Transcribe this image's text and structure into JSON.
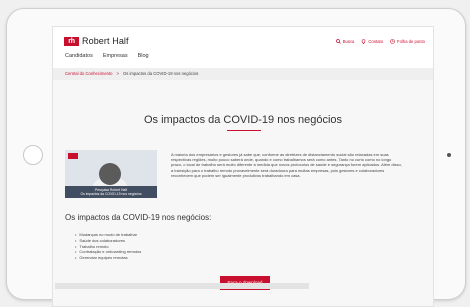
{
  "app": {
    "logo_mark": "rh",
    "logo_text": "Robert Half"
  },
  "utility": {
    "search": "Busca",
    "contact": "Contato",
    "payroll": "Folha de ponto"
  },
  "nav": [
    "Candidatos",
    "Empresas",
    "Blog"
  ],
  "breadcrumb": {
    "parent": "Central do Conhecimento",
    "separator": ">",
    "current": "Os impactos da COVID-19 nos negócios"
  },
  "page": {
    "title": "Os impactos da COVID-19 nos negócios",
    "card_caption_line1": "Pesquisa Robert Half",
    "card_caption_line2": "Os impactos da COVID-19 nos negócios",
    "paragraph": "A maioria dos empresários e gestores já sabe que, conforme as diretrizes de distanciamento social são relaxadas em suas respectivas regiões, muito pouco saberá onde, quando e como trabalhamos será como antes. Tanto no curto como no longo prazo, o local de trabalho será muito diferente à medida que novos protocolos de saúde e segurança forem aplicados. Além disso, a transição para o trabalho remoto provavelmente será duradoura para muitas empresas, pois gestores e colaboradores reconhecem que podem ser igualmente produtivos trabalhando em casa.",
    "subtitle": "Os impactos da COVID-19 nos negócios:",
    "bullets": [
      "Mudanças no modo de trabalhar",
      "Saúde dos colaboradores",
      "Trabalho remoto",
      "Contratação e onboarding remotos",
      "Gerenciar equipes remotas"
    ],
    "cta": "Faça o download"
  },
  "colors": {
    "brand": "#c8102e",
    "background": "#f7f7f7"
  }
}
